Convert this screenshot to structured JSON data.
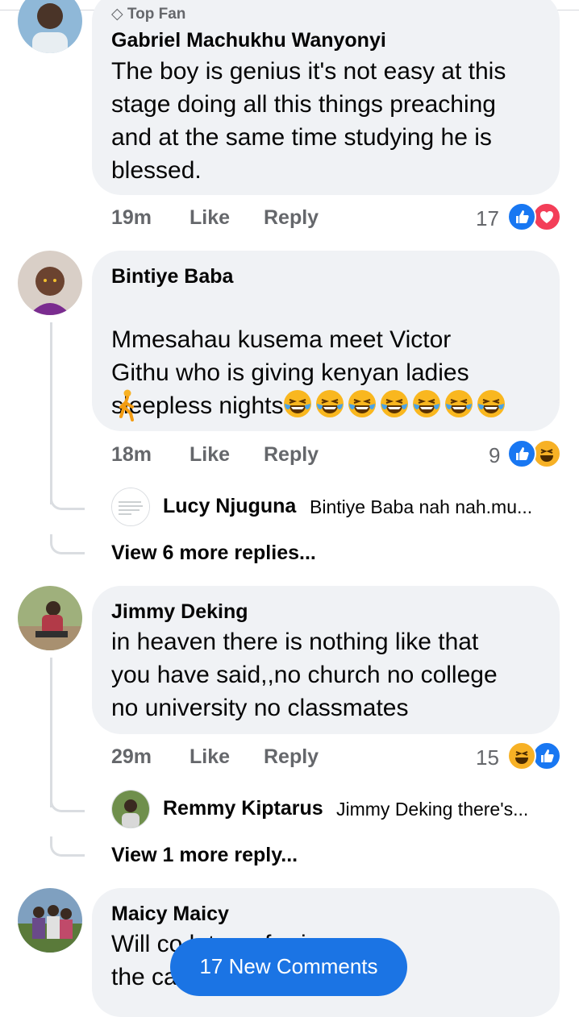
{
  "comments": [
    {
      "badge": "Top Fan",
      "author": "Gabriel Machukhu Wanyonyi",
      "text": "The boy is genius it's not easy at this\nstage doing all this things preaching\nand at the same time studying he is\nblessed.",
      "time": "19m",
      "like_label": "Like",
      "reply_label": "Reply",
      "reaction_count": "17",
      "reactions": [
        "like-icon",
        "love-icon"
      ]
    },
    {
      "author": "Bintiye Baba",
      "text": "Mmesahau kusema meet Victor\nGithu who is giving kenyan ladies\nsleepless nights",
      "emoji_count": 7,
      "time": "18m",
      "like_label": "Like",
      "reply_label": "Reply",
      "reaction_count": "9",
      "reactions": [
        "like-icon",
        "haha-icon"
      ],
      "reply_preview": {
        "author": "Lucy Njuguna",
        "text": "Bintiye Baba nah nah.mu..."
      },
      "more_replies": "View 6 more replies..."
    },
    {
      "author": "Jimmy Deking",
      "text": "in heaven there is nothing like that\nyou have said,,no church no college\nno university no classmates",
      "time": "29m",
      "like_label": "Like",
      "reply_label": "Reply",
      "reaction_count": "15",
      "reactions": [
        "haha-icon",
        "like-icon"
      ],
      "reply_preview": {
        "author": "Remmy Kiptarus",
        "text": "Jimmy Deking there's..."
      },
      "more_replies": "View 1 more reply..."
    },
    {
      "author": "Maicy Maicy",
      "text": "Will co                         later referring\nthe ca                        no started"
    }
  ],
  "new_comments_button": "17 New Comments",
  "colors": {
    "accent": "#1877f2",
    "bubble": "#f0f2f5",
    "love": "#f33e58",
    "haha": "#f7b125",
    "meta": "#65676b"
  }
}
